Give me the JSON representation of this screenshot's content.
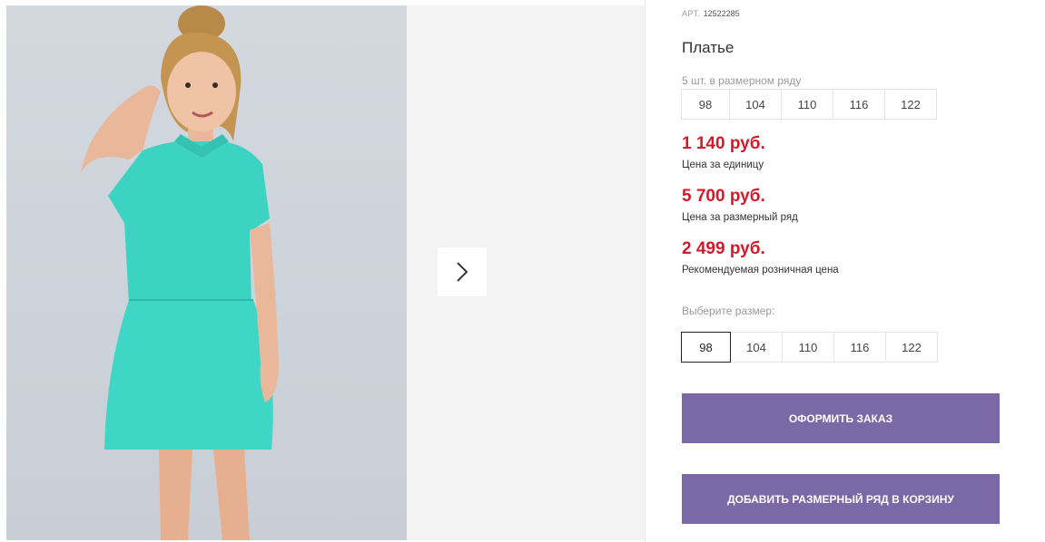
{
  "gallery": {
    "next_icon": "chevron-right-icon",
    "photo_alt": "product-photo"
  },
  "product": {
    "sku_label": "АРТ.",
    "sku_value": "12522285",
    "title": "Платье",
    "row_caption": "5 шт. в размерном ряду",
    "row_sizes": [
      "98",
      "104",
      "110",
      "116",
      "122"
    ]
  },
  "prices": {
    "unit_value": "1 140 руб.",
    "unit_label": "Цена за единицу",
    "row_value": "5 700 руб.",
    "row_label": "Цена за размерный ряд",
    "retail_value": "2 499 руб.",
    "retail_label": "Рекомендуемая розничная цена",
    "price_color": "#d7182a"
  },
  "size_selector": {
    "caption": "Выберите размер:",
    "options": [
      "98",
      "104",
      "110",
      "116",
      "122"
    ],
    "selected": "98"
  },
  "actions": {
    "order_label": "Оформить заказ",
    "add_row_label": "Добавить размерный ряд в корзину",
    "button_color": "#7b68a6"
  }
}
